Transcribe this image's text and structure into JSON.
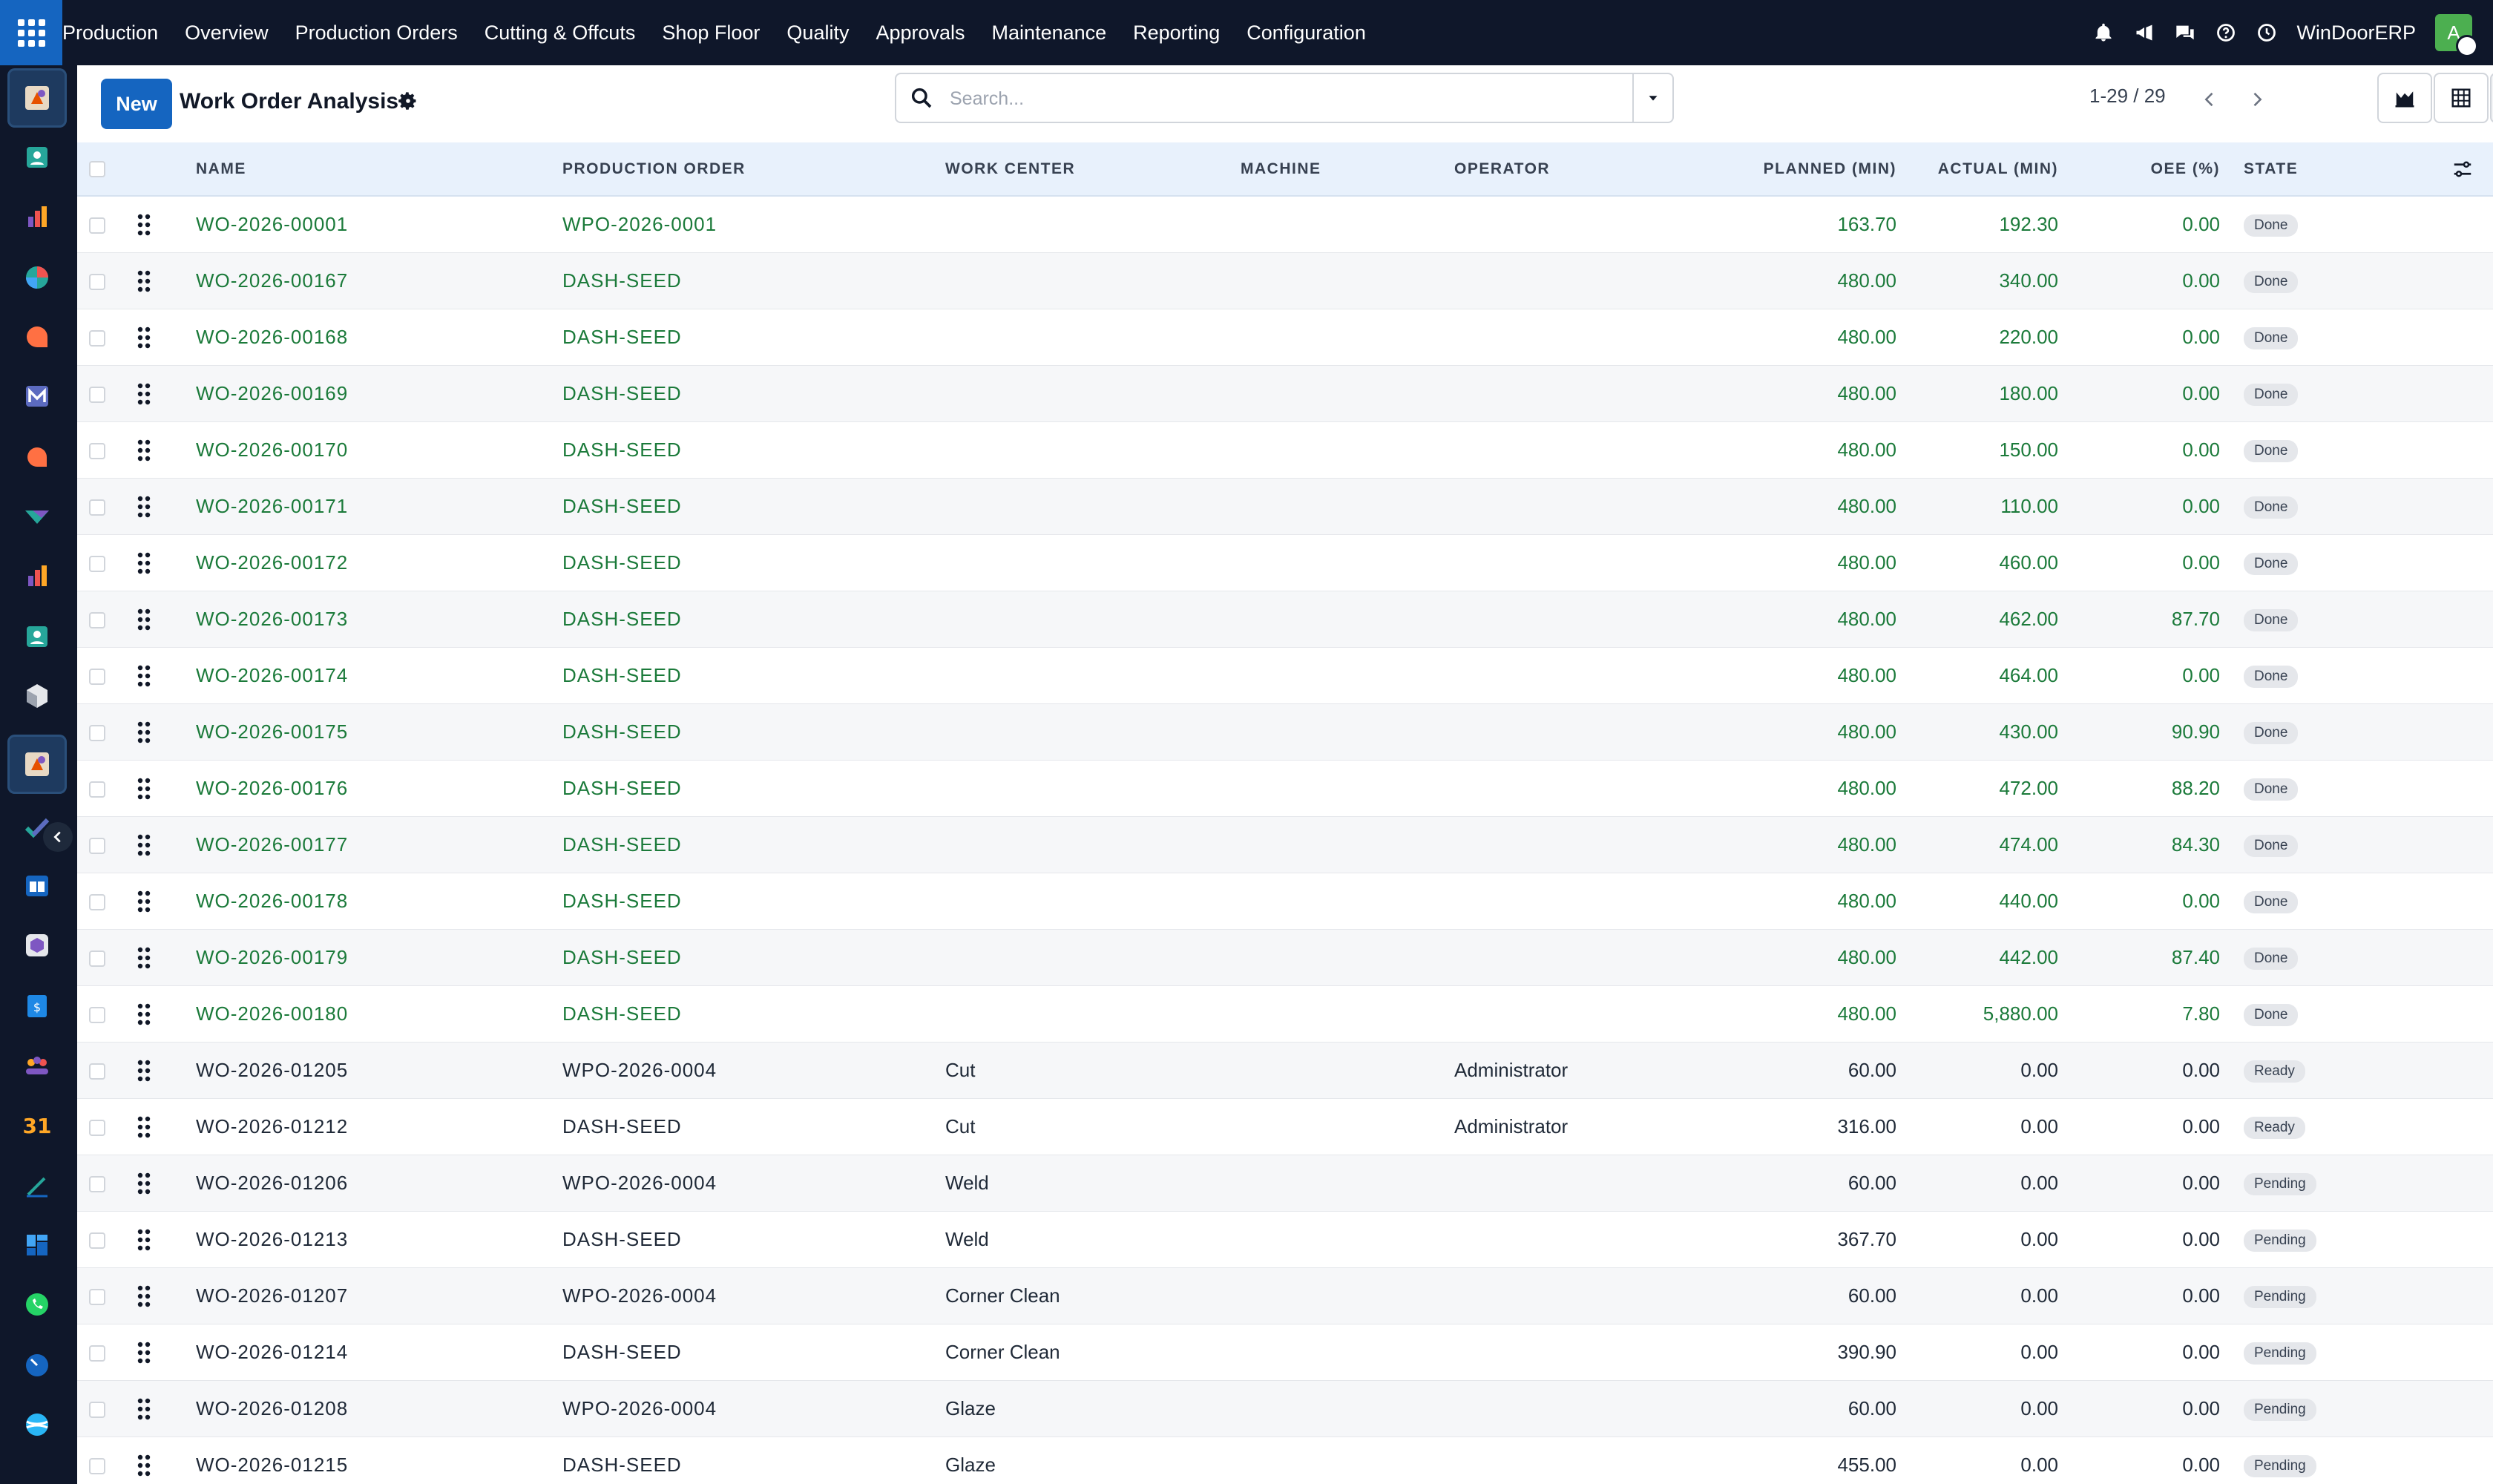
{
  "topbar": {
    "app_name": "Production",
    "menu": [
      "Overview",
      "Production Orders",
      "Cutting & Offcuts",
      "Shop Floor",
      "Quality",
      "Approvals",
      "Maintenance",
      "Reporting",
      "Configuration"
    ],
    "company": "WinDoorERP",
    "avatar_letter": "A",
    "icons": [
      "bell-icon",
      "megaphone-icon",
      "chat-icon",
      "help-icon",
      "clock-icon"
    ]
  },
  "sidebar": {
    "apps": [
      "production-app",
      "contacts-app",
      "reporting-app",
      "dashboard-app",
      "discuss-app",
      "mail-app",
      "chat-app",
      "mrp-app",
      "analytics-app",
      "employees-app",
      "inventory-app",
      "production-app-active",
      "project-app",
      "knowledge-app",
      "package-app",
      "invoicing-app",
      "team-app",
      "calendar-app",
      "sign-app",
      "spreadsheet-app",
      "whatsapp-app",
      "timesheet-app",
      "website-app"
    ]
  },
  "control": {
    "new_label": "New",
    "title": "Work Order Analysis",
    "search_placeholder": "Search...",
    "pager": "1-29 / 29"
  },
  "table": {
    "columns": {
      "name": "NAME",
      "order": "PRODUCTION ORDER",
      "center": "WORK CENTER",
      "machine": "MACHINE",
      "operator": "OPERATOR",
      "planned": "PLANNED (MIN)",
      "actual": "ACTUAL (MIN)",
      "oee": "OEE (%)",
      "state": "STATE"
    },
    "rows": [
      {
        "name": "WO-2026-00001",
        "order": "WPO-2026-0001",
        "center": "",
        "machine": "",
        "operator": "",
        "planned": "163.70",
        "actual": "192.30",
        "oee": "0.00",
        "state": "Done",
        "highlight": true
      },
      {
        "name": "WO-2026-00167",
        "order": "DASH-SEED",
        "center": "",
        "machine": "",
        "operator": "",
        "planned": "480.00",
        "actual": "340.00",
        "oee": "0.00",
        "state": "Done",
        "highlight": true
      },
      {
        "name": "WO-2026-00168",
        "order": "DASH-SEED",
        "center": "",
        "machine": "",
        "operator": "",
        "planned": "480.00",
        "actual": "220.00",
        "oee": "0.00",
        "state": "Done",
        "highlight": true
      },
      {
        "name": "WO-2026-00169",
        "order": "DASH-SEED",
        "center": "",
        "machine": "",
        "operator": "",
        "planned": "480.00",
        "actual": "180.00",
        "oee": "0.00",
        "state": "Done",
        "highlight": true
      },
      {
        "name": "WO-2026-00170",
        "order": "DASH-SEED",
        "center": "",
        "machine": "",
        "operator": "",
        "planned": "480.00",
        "actual": "150.00",
        "oee": "0.00",
        "state": "Done",
        "highlight": true
      },
      {
        "name": "WO-2026-00171",
        "order": "DASH-SEED",
        "center": "",
        "machine": "",
        "operator": "",
        "planned": "480.00",
        "actual": "110.00",
        "oee": "0.00",
        "state": "Done",
        "highlight": true
      },
      {
        "name": "WO-2026-00172",
        "order": "DASH-SEED",
        "center": "",
        "machine": "",
        "operator": "",
        "planned": "480.00",
        "actual": "460.00",
        "oee": "0.00",
        "state": "Done",
        "highlight": true
      },
      {
        "name": "WO-2026-00173",
        "order": "DASH-SEED",
        "center": "",
        "machine": "",
        "operator": "",
        "planned": "480.00",
        "actual": "462.00",
        "oee": "87.70",
        "state": "Done",
        "highlight": true
      },
      {
        "name": "WO-2026-00174",
        "order": "DASH-SEED",
        "center": "",
        "machine": "",
        "operator": "",
        "planned": "480.00",
        "actual": "464.00",
        "oee": "0.00",
        "state": "Done",
        "highlight": true
      },
      {
        "name": "WO-2026-00175",
        "order": "DASH-SEED",
        "center": "",
        "machine": "",
        "operator": "",
        "planned": "480.00",
        "actual": "430.00",
        "oee": "90.90",
        "state": "Done",
        "highlight": true
      },
      {
        "name": "WO-2026-00176",
        "order": "DASH-SEED",
        "center": "",
        "machine": "",
        "operator": "",
        "planned": "480.00",
        "actual": "472.00",
        "oee": "88.20",
        "state": "Done",
        "highlight": true
      },
      {
        "name": "WO-2026-00177",
        "order": "DASH-SEED",
        "center": "",
        "machine": "",
        "operator": "",
        "planned": "480.00",
        "actual": "474.00",
        "oee": "84.30",
        "state": "Done",
        "highlight": true
      },
      {
        "name": "WO-2026-00178",
        "order": "DASH-SEED",
        "center": "",
        "machine": "",
        "operator": "",
        "planned": "480.00",
        "actual": "440.00",
        "oee": "0.00",
        "state": "Done",
        "highlight": true
      },
      {
        "name": "WO-2026-00179",
        "order": "DASH-SEED",
        "center": "",
        "machine": "",
        "operator": "",
        "planned": "480.00",
        "actual": "442.00",
        "oee": "87.40",
        "state": "Done",
        "highlight": true
      },
      {
        "name": "WO-2026-00180",
        "order": "DASH-SEED",
        "center": "",
        "machine": "",
        "operator": "",
        "planned": "480.00",
        "actual": "5,880.00",
        "oee": "7.80",
        "state": "Done",
        "highlight": true
      },
      {
        "name": "WO-2026-01205",
        "order": "WPO-2026-0004",
        "center": "Cut",
        "machine": "",
        "operator": "Administrator",
        "planned": "60.00",
        "actual": "0.00",
        "oee": "0.00",
        "state": "Ready",
        "highlight": false
      },
      {
        "name": "WO-2026-01212",
        "order": "DASH-SEED",
        "center": "Cut",
        "machine": "",
        "operator": "Administrator",
        "planned": "316.00",
        "actual": "0.00",
        "oee": "0.00",
        "state": "Ready",
        "highlight": false
      },
      {
        "name": "WO-2026-01206",
        "order": "WPO-2026-0004",
        "center": "Weld",
        "machine": "",
        "operator": "",
        "planned": "60.00",
        "actual": "0.00",
        "oee": "0.00",
        "state": "Pending",
        "highlight": false
      },
      {
        "name": "WO-2026-01213",
        "order": "DASH-SEED",
        "center": "Weld",
        "machine": "",
        "operator": "",
        "planned": "367.70",
        "actual": "0.00",
        "oee": "0.00",
        "state": "Pending",
        "highlight": false
      },
      {
        "name": "WO-2026-01207",
        "order": "WPO-2026-0004",
        "center": "Corner Clean",
        "machine": "",
        "operator": "",
        "planned": "60.00",
        "actual": "0.00",
        "oee": "0.00",
        "state": "Pending",
        "highlight": false
      },
      {
        "name": "WO-2026-01214",
        "order": "DASH-SEED",
        "center": "Corner Clean",
        "machine": "",
        "operator": "",
        "planned": "390.90",
        "actual": "0.00",
        "oee": "0.00",
        "state": "Pending",
        "highlight": false
      },
      {
        "name": "WO-2026-01208",
        "order": "WPO-2026-0004",
        "center": "Glaze",
        "machine": "",
        "operator": "",
        "planned": "60.00",
        "actual": "0.00",
        "oee": "0.00",
        "state": "Pending",
        "highlight": false
      },
      {
        "name": "WO-2026-01215",
        "order": "DASH-SEED",
        "center": "Glaze",
        "machine": "",
        "operator": "",
        "planned": "455.00",
        "actual": "0.00",
        "oee": "0.00",
        "state": "Pending",
        "highlight": false
      }
    ]
  },
  "colors": {
    "primary": "#1565c0",
    "navbar": "#0f172a",
    "link_green": "#1b7a3a",
    "header_bg": "#e8f1fc"
  }
}
